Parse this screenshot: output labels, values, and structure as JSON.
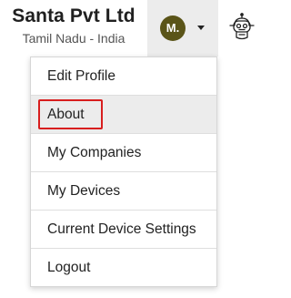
{
  "header": {
    "company_name": "Santa Pvt Ltd",
    "company_location": "Tamil Nadu - India",
    "avatar_initials": "M.",
    "avatar_color": "#5a5418"
  },
  "menu": {
    "items": [
      {
        "label": "Edit Profile"
      },
      {
        "label": "About",
        "highlighted": true
      },
      {
        "label": "My Companies"
      },
      {
        "label": "My Devices"
      },
      {
        "label": "Current Device Settings"
      },
      {
        "label": "Logout"
      }
    ],
    "highlight_color": "#d81e1e"
  }
}
